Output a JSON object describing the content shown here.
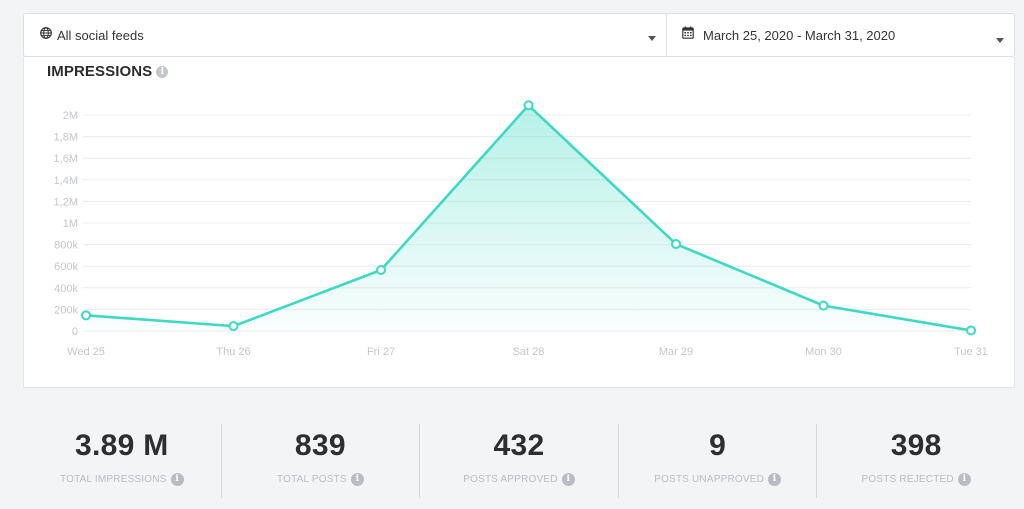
{
  "filters": {
    "feeds": {
      "label": "All social feeds",
      "icon": "globe-icon"
    },
    "dates": {
      "label": "March 25, 2020 - March 31, 2020",
      "icon": "calendar-icon"
    }
  },
  "chart": {
    "title": "IMPRESSIONS"
  },
  "chart_data": {
    "type": "area",
    "title": "IMPRESSIONS",
    "categories": [
      "Wed 25",
      "Thu 26",
      "Fri 27",
      "Sat 28",
      "Mar 29",
      "Mon 30",
      "Tue 31"
    ],
    "series": [
      {
        "values": [
          145000,
          45000,
          565000,
          2090000,
          805000,
          235000,
          5000
        ]
      }
    ],
    "y_ticks": [
      "0",
      "200k",
      "400k",
      "600k",
      "800k",
      "1M",
      "1,2M",
      "1,4M",
      "1,6M",
      "1,8M",
      "2M"
    ],
    "ylim": [
      0,
      2000000
    ],
    "grid": true,
    "colors": {
      "line": "#3dd9c1",
      "fill": "#3dd9c1",
      "grid": "#ececec",
      "tick": "#c4c6ca"
    }
  },
  "stats": [
    {
      "value": "3.89 M",
      "label": "TOTAL IMPRESSIONS"
    },
    {
      "value": "839",
      "label": "TOTAL POSTS"
    },
    {
      "value": "432",
      "label": "POSTS APPROVED"
    },
    {
      "value": "9",
      "label": "POSTS UNAPPROVED"
    },
    {
      "value": "398",
      "label": "POSTS REJECTED"
    }
  ]
}
